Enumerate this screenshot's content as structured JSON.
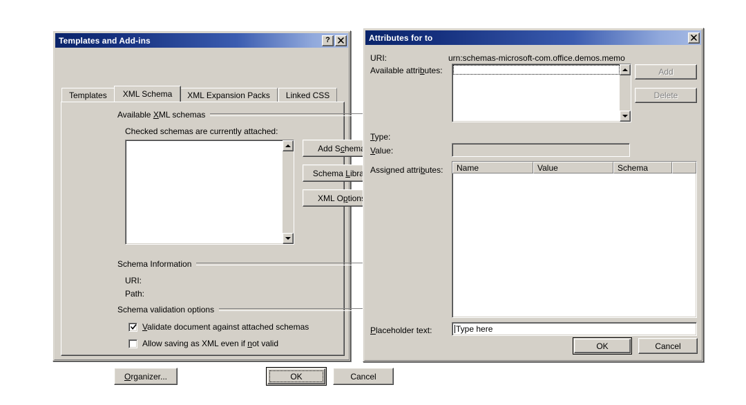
{
  "templates_dialog": {
    "title": "Templates and Add-ins",
    "help_button": "?",
    "close_button": "✕",
    "tabs": [
      {
        "label": "Templates",
        "active": false
      },
      {
        "label": "XML Schema",
        "active": true
      },
      {
        "label": "XML Expansion Packs",
        "active": false
      },
      {
        "label": "Linked CSS",
        "active": false
      }
    ],
    "group_available": "Available XML schemas",
    "list_caption": "Checked schemas are currently attached:",
    "schema_list_items": [],
    "buttons": {
      "add_schema": "Add Schema...",
      "schema_library": "Schema Library...",
      "xml_options": "XML Options..."
    },
    "group_schema_info": "Schema Information",
    "uri_label": "URI:",
    "uri_value": "",
    "path_label": "Path:",
    "path_value": "",
    "group_validation": "Schema validation options",
    "checkboxes": [
      {
        "label": "Validate document against attached schemas",
        "checked": true
      },
      {
        "label": "Allow saving as XML even if not valid",
        "checked": false
      }
    ],
    "footer": {
      "organizer": "Organizer...",
      "ok": "OK",
      "cancel": "Cancel"
    }
  },
  "attributes_dialog": {
    "title": "Attributes for to",
    "close_button": "✕",
    "uri_label": "URI:",
    "uri_value": "urn:schemas-microsoft-com.office.demos.memo",
    "available_label": "Available attributes:",
    "available_items": [],
    "add_button": "Add",
    "add_enabled": false,
    "delete_button": "Delete",
    "delete_enabled": false,
    "type_label": "Type:",
    "type_value": "",
    "value_label": "Value:",
    "value_text": "",
    "assigned_label": "Assigned attributes:",
    "assigned_columns": [
      "Name",
      "Value",
      "Schema",
      ""
    ],
    "assigned_rows": [],
    "placeholder_label": "Placeholder text:",
    "placeholder_value": "Type here",
    "footer": {
      "ok": "OK",
      "cancel": "Cancel"
    }
  },
  "theme": {
    "face": "#d4d0c8",
    "title_start": "#0a246a",
    "title_end": "#a6bae4",
    "disabled_text": "#808080",
    "page_bg": "#ffffff"
  }
}
